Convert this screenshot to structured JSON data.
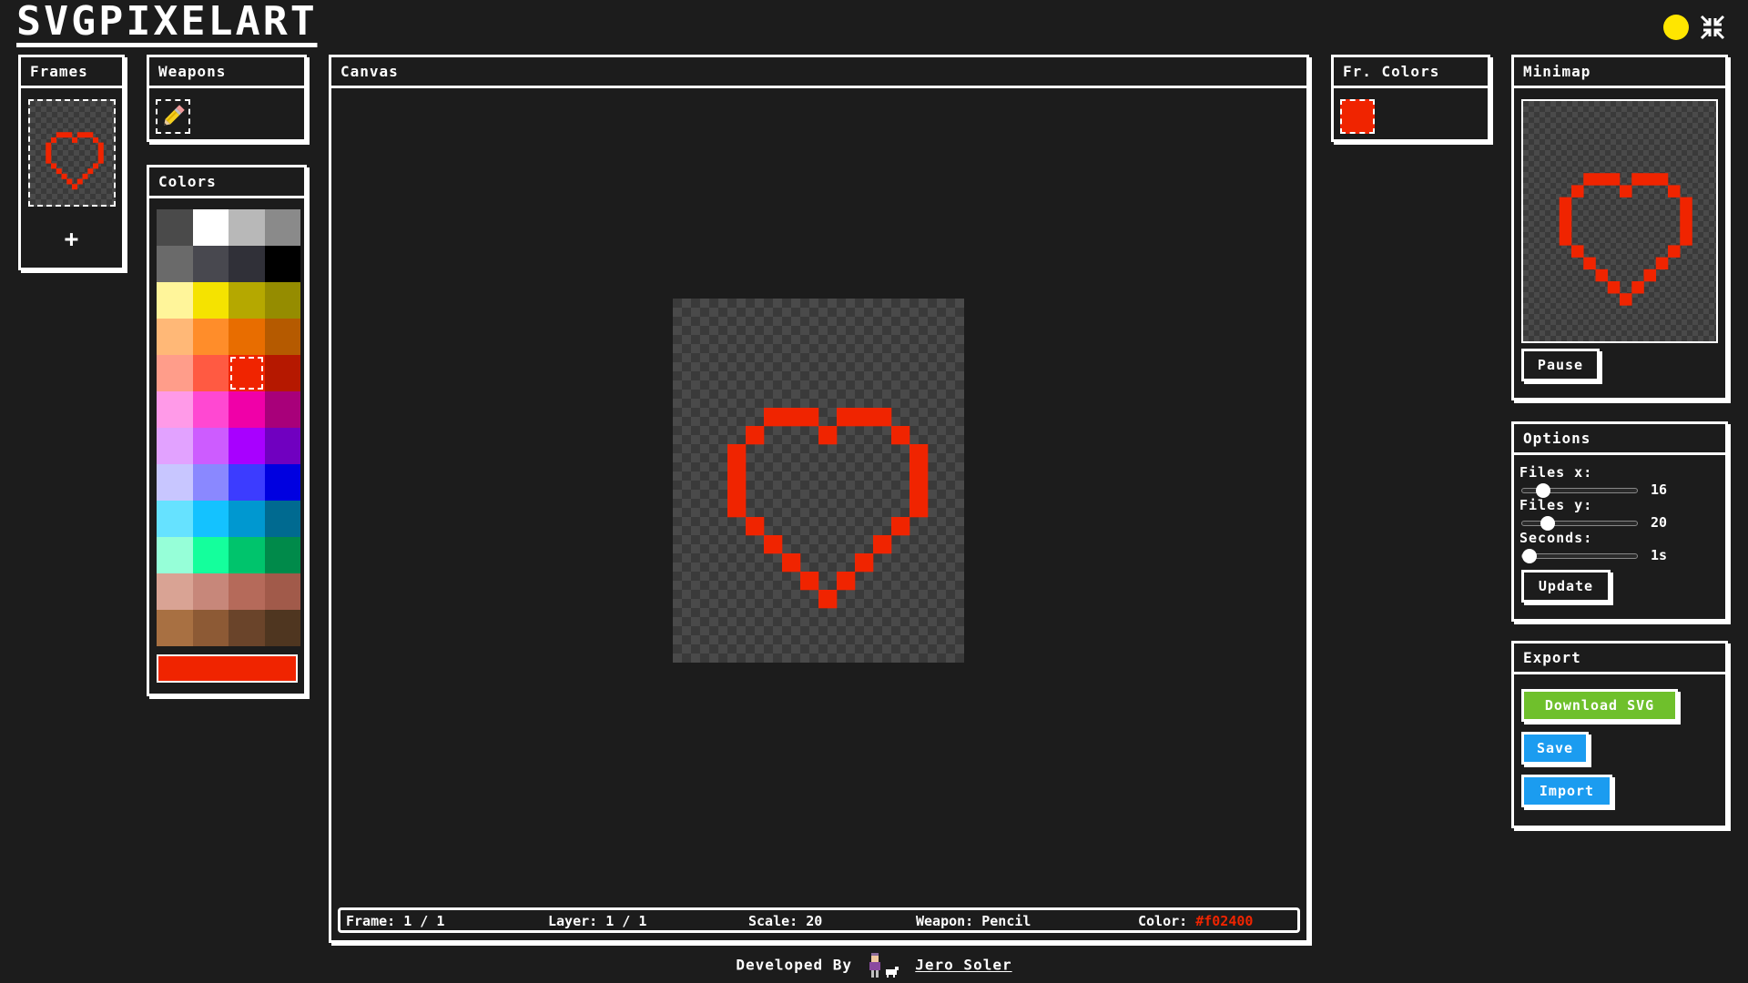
{
  "app": {
    "title": "SVGPIXELART"
  },
  "header": {
    "theme_icon": "sun-icon",
    "fullscreen_icon": "exit-fullscreen-icon"
  },
  "frames": {
    "title": "Frames",
    "add_label": "+"
  },
  "weapons": {
    "title": "Weapons",
    "items": [
      {
        "name": "Pencil",
        "icon": "pencil-icon",
        "selected": true
      }
    ]
  },
  "colors": {
    "title": "Colors",
    "palette": [
      "#4a4a4a",
      "#ffffff",
      "#b8b8b8",
      "#8a8a8a",
      "#6a6a6a",
      "#48484f",
      "#303038",
      "#000000",
      "#fff59a",
      "#f5e300",
      "#b5a800",
      "#958c00",
      "#ffb877",
      "#ff8d2a",
      "#e86d00",
      "#b55a00",
      "#ff9d8a",
      "#ff5a42",
      "#f02400",
      "#b51800",
      "#ff9ae8",
      "#ff48d2",
      "#f000a8",
      "#a8007a",
      "#e2a2ff",
      "#cd5cff",
      "#a800ff",
      "#7000c0",
      "#c8c6ff",
      "#8a88ff",
      "#3c3cff",
      "#0000e0",
      "#66e2ff",
      "#14c2ff",
      "#0098d0",
      "#006a90",
      "#96ffd8",
      "#14ff9c",
      "#00c46c",
      "#008a4a",
      "#d9a394",
      "#c7877a",
      "#b56a5a",
      "#a15a4a",
      "#a87042",
      "#8d5a35",
      "#6a442a",
      "#4f3620"
    ],
    "selected_index": 18,
    "current": "#f02400"
  },
  "canvas": {
    "title": "Canvas",
    "status": {
      "frame_label": "Frame:",
      "frame_value": "1 / 1",
      "layer_label": "Layer:",
      "layer_value": "1 / 1",
      "scale_label": "Scale:",
      "scale_value": "20",
      "weapon_label": "Weapon:",
      "weapon_value": "Pencil",
      "color_label": "Color:",
      "color_value": "#f02400"
    }
  },
  "fr_colors": {
    "title": "Fr. Colors",
    "items": [
      "#f02400"
    ]
  },
  "minimap": {
    "title": "Minimap",
    "pause_label": "Pause"
  },
  "options": {
    "title": "Options",
    "files_x_label": "Files x:",
    "files_x_value": "16",
    "files_y_label": "Files y:",
    "files_y_value": "20",
    "seconds_label": "Seconds:",
    "seconds_value": "1s",
    "update_label": "Update"
  },
  "export": {
    "title": "Export",
    "download_label": "Download SVG",
    "save_label": "Save",
    "import_label": "Import"
  },
  "footer": {
    "developed_by": "Developed By",
    "author": "Jero Soler"
  },
  "art": {
    "grid_cols": 16,
    "grid_rows": 20,
    "color": "#f02400",
    "pixels": [
      [
        5,
        6
      ],
      [
        6,
        6
      ],
      [
        7,
        6
      ],
      [
        9,
        6
      ],
      [
        10,
        6
      ],
      [
        11,
        6
      ],
      [
        4,
        7
      ],
      [
        8,
        7
      ],
      [
        12,
        7
      ],
      [
        3,
        8
      ],
      [
        13,
        8
      ],
      [
        3,
        9
      ],
      [
        13,
        9
      ],
      [
        3,
        10
      ],
      [
        13,
        10
      ],
      [
        3,
        11
      ],
      [
        13,
        11
      ],
      [
        4,
        12
      ],
      [
        12,
        12
      ],
      [
        5,
        13
      ],
      [
        11,
        13
      ],
      [
        6,
        14
      ],
      [
        10,
        14
      ],
      [
        7,
        15
      ],
      [
        9,
        15
      ],
      [
        8,
        16
      ]
    ]
  }
}
